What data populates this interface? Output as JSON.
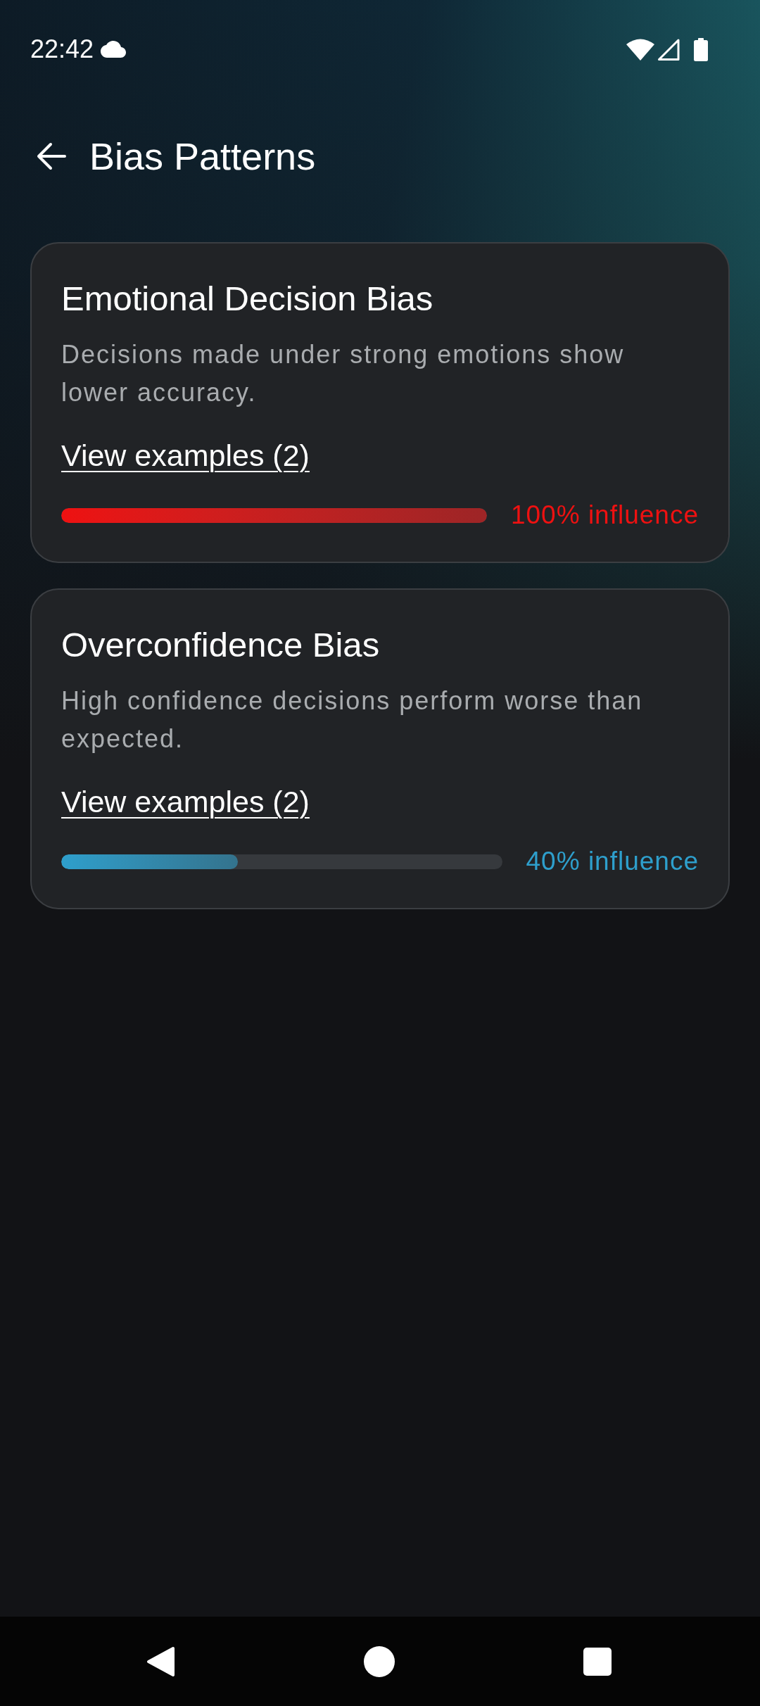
{
  "status_bar": {
    "time": "22:42"
  },
  "header": {
    "title": "Bias Patterns"
  },
  "biases": [
    {
      "title": "Emotional Decision Bias",
      "description": "Decisions made under strong emotions show lower accuracy.",
      "link": "View examples (2)",
      "level": 1.0,
      "reading": "100% influence",
      "color": "#ee1111"
    },
    {
      "title": "Overconfidence Bias",
      "description": "High confidence decisions perform worse than expected.",
      "link": "View examples (2)",
      "level": 0.4,
      "reading": "40% influence",
      "color": "#2e9fcc"
    }
  ]
}
